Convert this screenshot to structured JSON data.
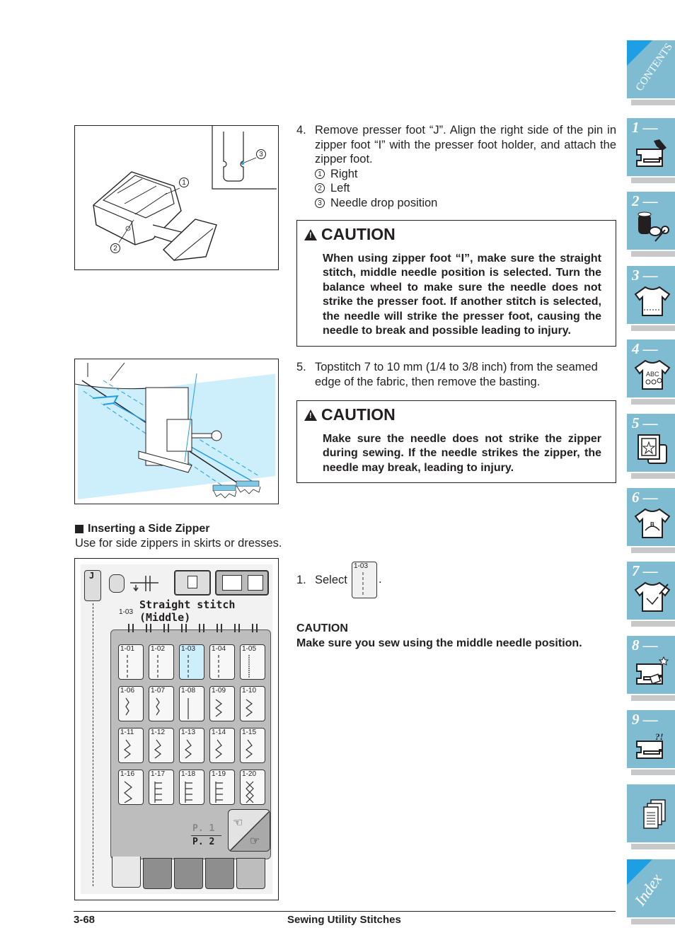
{
  "step4": {
    "number": "4.",
    "text": "Remove presser foot “J”. Align the right side of the pin in zipper foot “I” with the presser foot holder, and attach the zipper foot.",
    "legend": [
      {
        "marker": "1",
        "label": "Right"
      },
      {
        "marker": "2",
        "label": "Left"
      },
      {
        "marker": "3",
        "label": "Needle drop position"
      }
    ]
  },
  "caution1": {
    "title": "CAUTION",
    "text": "When using zipper foot “I”, make sure the straight stitch, middle needle position is selected. Turn the balance wheel to make sure the needle does not strike the presser foot. If another stitch is selected, the needle will strike the presser foot, causing the needle to break and possible leading to injury."
  },
  "step5": {
    "number": "5.",
    "text": "Topstitch 7 to 10 mm (1/4 to 3/8 inch) from the seamed edge of the fabric, then remove the basting."
  },
  "caution2": {
    "title": "CAUTION",
    "text": "Make sure the needle does not strike the zipper during sewing. If the needle strikes the zipper, the needle may break, leading to injury."
  },
  "section": {
    "title": "Inserting a Side Zipper",
    "subtitle": "Use for side zippers in skirts or dresses."
  },
  "step1": {
    "number": "1.",
    "select_label": "Select",
    "select_key": "1-03",
    "after": "."
  },
  "caution3": {
    "title": "CAUTION",
    "text": "Make sure you sew using the middle needle position."
  },
  "figure1": {
    "callouts": [
      "1",
      "2",
      "3"
    ]
  },
  "lcd": {
    "foot_label": "J",
    "stitch_code": "1-03",
    "stitch_name_line1": "Straight stitch",
    "stitch_name_line2": "(Middle)",
    "selected_key": "1-03",
    "keys": [
      "1-01",
      "1-02",
      "1-03",
      "1-04",
      "1-05",
      "1-06",
      "1-07",
      "1-08",
      "1-09",
      "1-10",
      "1-11",
      "1-12",
      "1-13",
      "1-14",
      "1-15",
      "1-16",
      "1-17",
      "1-18",
      "1-19",
      "1-20"
    ],
    "page_current": "P. 1",
    "page_total": "P. 2",
    "bottom_tabs": [
      "utility-stitches",
      "decorative-satin",
      "cross-stitch",
      "buttonhole",
      "direction-stitches"
    ]
  },
  "sidebar": {
    "tabs": [
      {
        "label": "CONTENTS",
        "icon": "contents"
      },
      {
        "label": "1 —",
        "icon": "sewing-machine-hand-icon"
      },
      {
        "label": "2 —",
        "icon": "thread-scissors-icon"
      },
      {
        "label": "3 —",
        "icon": "tshirt-stitch-icon"
      },
      {
        "label": "4 —",
        "icon": "tshirt-abc-icon",
        "icon_text": "ABC"
      },
      {
        "label": "5 —",
        "icon": "embroidery-frame-icon"
      },
      {
        "label": "6 —",
        "icon": "tshirt-edit-icon"
      },
      {
        "label": "7 —",
        "icon": "tshirt-pen-icon"
      },
      {
        "label": "8 —",
        "icon": "machine-cleaning-icon"
      },
      {
        "label": "9 —",
        "icon": "machine-trouble-icon",
        "icon_text": "?!"
      },
      {
        "label": "",
        "icon": "documents-icon"
      },
      {
        "label": "Index",
        "icon": "index"
      }
    ]
  },
  "footer": {
    "page_number": "3-68",
    "chapter_title": "Sewing Utility Stitches"
  }
}
